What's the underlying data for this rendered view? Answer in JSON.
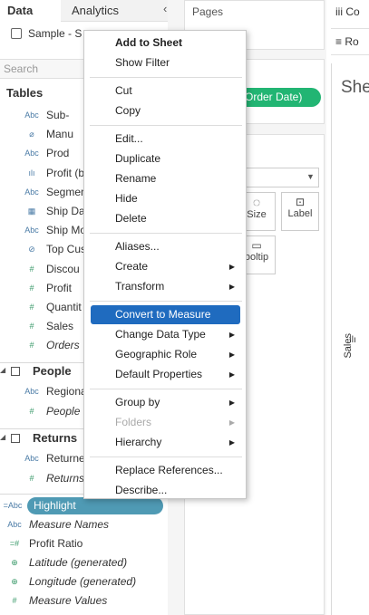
{
  "tabs": {
    "data": "Data",
    "analytics": "Analytics",
    "collapse": "‹"
  },
  "datasource": {
    "name": "Sample - S"
  },
  "search": {
    "placeholder": "Search"
  },
  "tables_header": "Tables",
  "orders_fields": [
    {
      "icon": "Abc",
      "label": "Sub-",
      "kind": "dim"
    },
    {
      "icon": "⌀",
      "label": "Manu",
      "kind": "dim"
    },
    {
      "icon": "Abc",
      "label": "Prod",
      "kind": "dim"
    },
    {
      "icon": "ılı",
      "label": "Profit (b",
      "kind": "dim"
    },
    {
      "icon": "Abc",
      "label": "Segmen",
      "kind": "dim"
    },
    {
      "icon": "▦",
      "label": "Ship Da",
      "kind": "dim"
    },
    {
      "icon": "Abc",
      "label": "Ship Mo",
      "kind": "dim"
    },
    {
      "icon": "⊘",
      "label": "Top Cus",
      "kind": "dim"
    },
    {
      "icon": "#",
      "label": "Discou",
      "kind": "mea"
    },
    {
      "icon": "#",
      "label": "Profit",
      "kind": "mea"
    },
    {
      "icon": "#",
      "label": "Quantit",
      "kind": "mea"
    },
    {
      "icon": "#",
      "label": "Sales",
      "kind": "mea"
    },
    {
      "icon": "#",
      "label": "Orders",
      "kind": "mea-italic"
    }
  ],
  "people": {
    "header": "People",
    "fields": [
      {
        "icon": "Abc",
        "label": "Regiona"
      },
      {
        "icon": "#",
        "label": "People"
      }
    ]
  },
  "returns": {
    "header": "Returns",
    "fields": [
      {
        "icon": "Abc",
        "label": "Returne"
      },
      {
        "icon": "#",
        "label": "Returns"
      }
    ]
  },
  "bottom_fields": [
    {
      "icon": "=Abc",
      "label": "Highlight"
    },
    {
      "icon": "Abc",
      "label": "Measure Names"
    },
    {
      "icon": "=#",
      "label": "Profit Ratio"
    },
    {
      "icon": "⊕",
      "label": "Latitude (generated)"
    },
    {
      "icon": "⊕",
      "label": "Longitude (generated)"
    },
    {
      "icon": "#",
      "label": "Measure Values"
    }
  ],
  "shelves": {
    "pages": "Pages",
    "columns_icon": "iii",
    "columns": "Co",
    "rows_icon": "≡",
    "rows": "Ro",
    "order_pill": "Order Date)",
    "size": "Size",
    "label": "Label",
    "tooltip": "ooltip"
  },
  "sheet": {
    "title": "She",
    "axis": "Sales"
  },
  "menu": {
    "items": [
      {
        "label": "Add to Sheet",
        "bold": true
      },
      {
        "label": "Show Filter"
      },
      {
        "label": "Cut"
      },
      {
        "label": "Copy"
      },
      {
        "label": "Edit..."
      },
      {
        "label": "Duplicate"
      },
      {
        "label": "Rename"
      },
      {
        "label": "Hide"
      },
      {
        "label": "Delete"
      },
      {
        "label": "Aliases..."
      },
      {
        "label": "Create",
        "submenu": true
      },
      {
        "label": "Transform",
        "submenu": true
      },
      {
        "label": "Convert to Measure",
        "selected": true
      },
      {
        "label": "Change Data Type",
        "submenu": true
      },
      {
        "label": "Geographic Role",
        "submenu": true
      },
      {
        "label": "Default Properties",
        "submenu": true
      },
      {
        "label": "Group by",
        "submenu": true
      },
      {
        "label": "Folders",
        "submenu": true,
        "disabled": true
      },
      {
        "label": "Hierarchy",
        "submenu": true
      },
      {
        "label": "Replace References..."
      },
      {
        "label": "Describe..."
      }
    ]
  },
  "colors": {
    "selected": "#1f6bbf",
    "pill_green": "#22b573",
    "pill_highlight": "#4f9ab4"
  }
}
